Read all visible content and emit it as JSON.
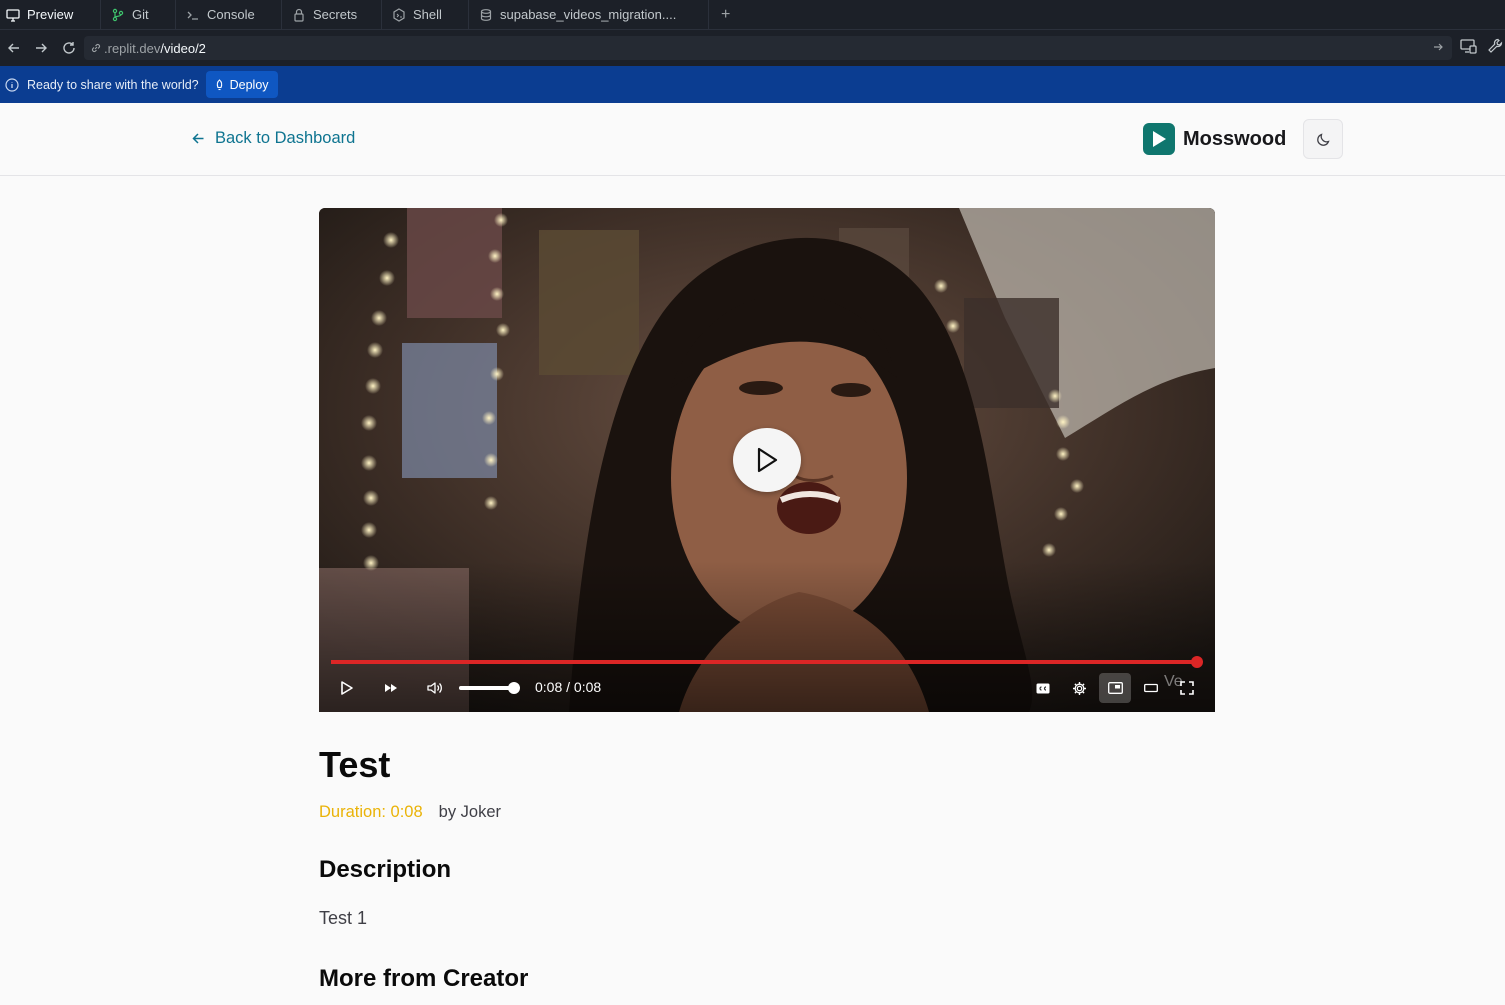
{
  "tabs": [
    {
      "label": "Preview",
      "icon": "monitor-icon"
    },
    {
      "label": "Git",
      "icon": "git-branch-icon"
    },
    {
      "label": "Console",
      "icon": "terminal-icon"
    },
    {
      "label": "Secrets",
      "icon": "lock-icon"
    },
    {
      "label": "Shell",
      "icon": "shell-icon"
    },
    {
      "label": "supabase_videos_migration....",
      "icon": "database-icon"
    }
  ],
  "tab_add_label": "+",
  "url": {
    "host": ".replit.dev",
    "path": "/video/2"
  },
  "banner": {
    "text": "Ready to share with the world?",
    "deploy_label": "Deploy"
  },
  "header": {
    "back_label": "Back to Dashboard",
    "brand_name": "Mosswood"
  },
  "player": {
    "current_time": "0:08",
    "separator": " / ",
    "total_time": "0:08",
    "progress": 1.0,
    "volume": 0.95,
    "overlay_text": "Ve"
  },
  "video": {
    "title": "Test",
    "duration_label": "Duration: 0:08",
    "author_label": "by Joker"
  },
  "sections": {
    "description_heading": "Description",
    "description_text": "Test 1",
    "more_heading": "More from Creator"
  },
  "colors": {
    "accent": "#0e7490",
    "brand": "#0f766e",
    "progress": "#dc2626",
    "duration": "#eab308",
    "banner": "#0b3d91"
  }
}
